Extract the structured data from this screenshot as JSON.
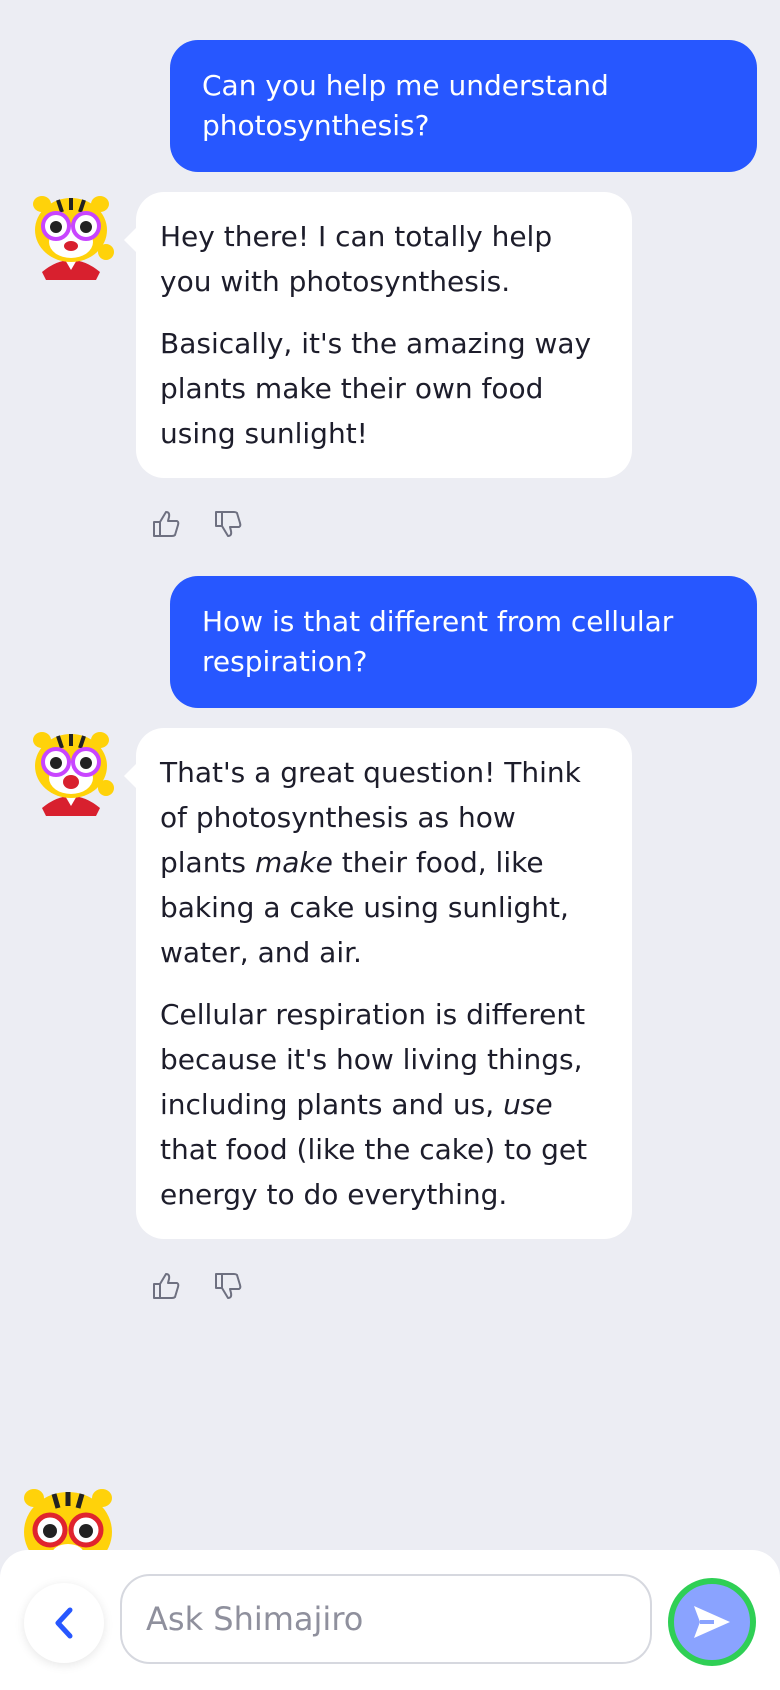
{
  "messages": [
    {
      "role": "user",
      "text": "Can you help me understand photosynthesis?"
    },
    {
      "role": "bot",
      "paragraphs": [
        "Hey there! I can totally help you with photosynthesis.",
        "Basically, it's the amazing way plants make their own food using sunlight!"
      ]
    },
    {
      "role": "user",
      "text": "How is that different from cellular respiration?"
    },
    {
      "role": "bot",
      "paragraphs": [
        {
          "before": "That's a great question! Think of photosynthesis as how plants ",
          "em": "make",
          "after": " their food, like baking a cake using sunlight, water, and air."
        },
        {
          "before": "Cellular respiration is different because it's how living things, including plants and us, ",
          "em": "use",
          "after": " that food (like the cake) to get energy to do everything."
        }
      ]
    }
  ],
  "composer": {
    "placeholder": "Ask Shimajiro",
    "value": ""
  },
  "icons": {
    "back": "chevron-left-icon",
    "send": "send-arrow-icon",
    "like": "thumbs-up-icon",
    "dislike": "thumbs-down-icon"
  },
  "colors": {
    "background": "#ecedf3",
    "user_bubble": "#2757ff",
    "send_button": "#8aa3ff",
    "send_ring": "#2fcf55",
    "back_chevron": "#2757ff"
  }
}
